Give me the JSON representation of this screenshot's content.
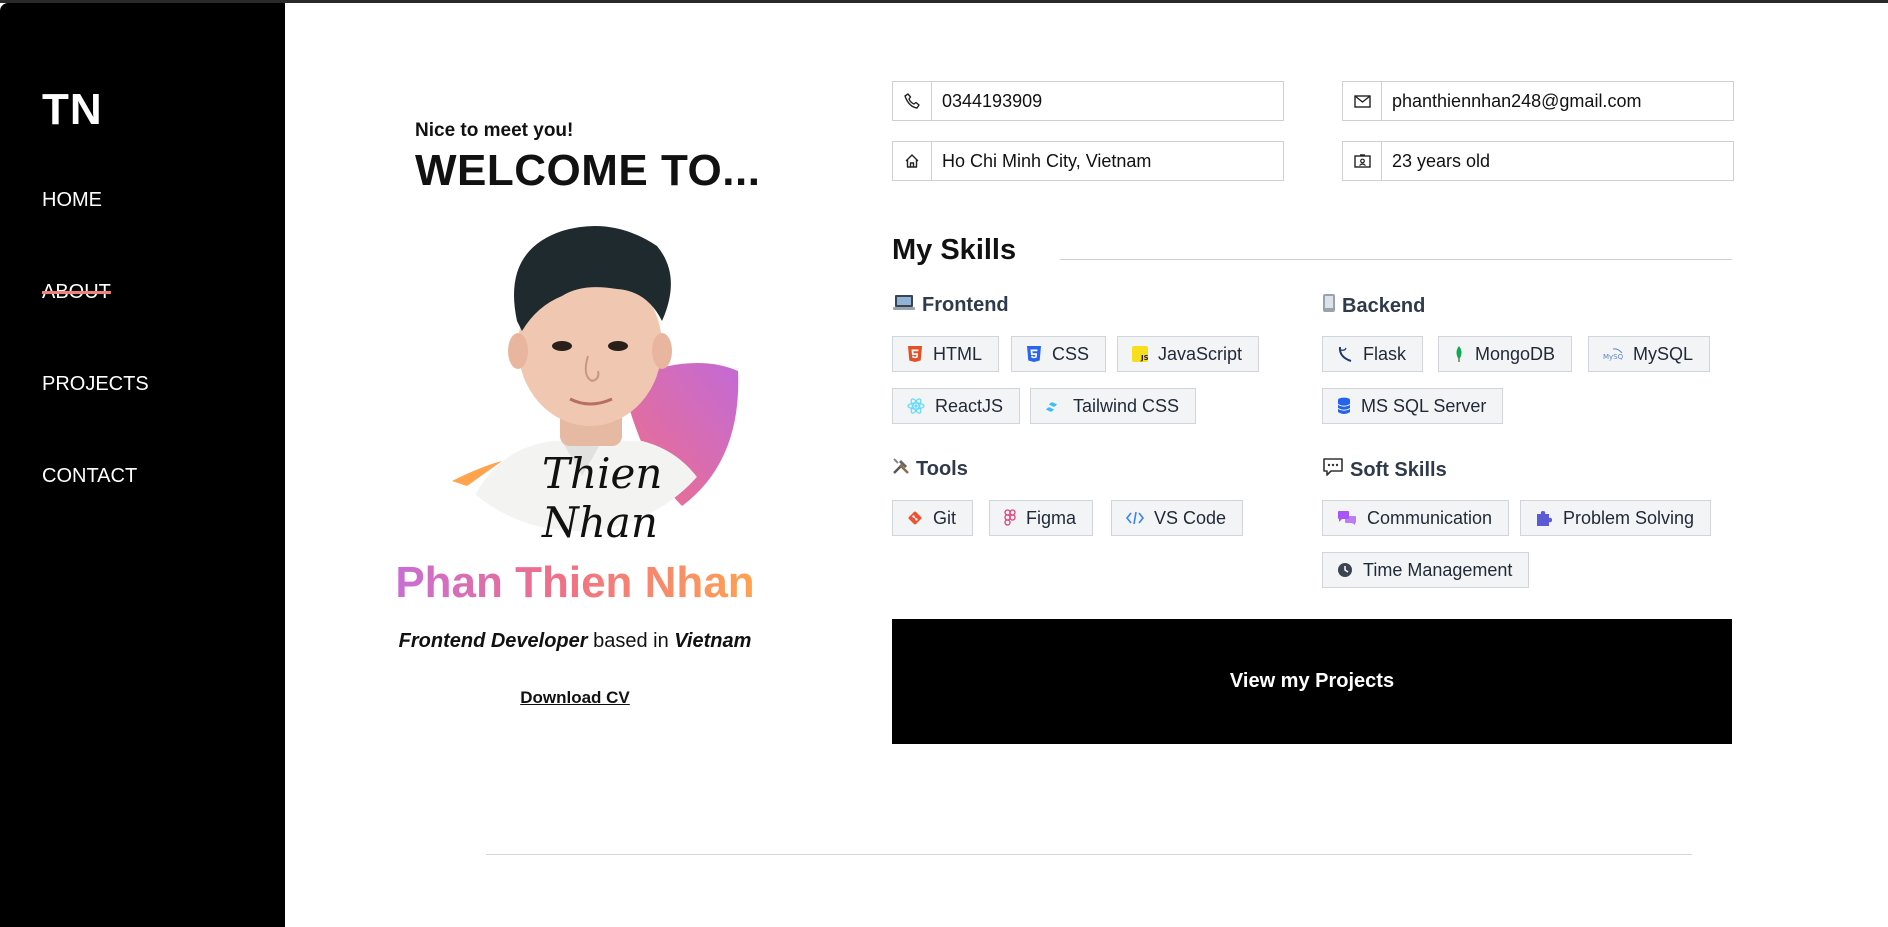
{
  "sidebar": {
    "logo": "TN",
    "nav": [
      {
        "label": "HOME"
      },
      {
        "label": "ABOUT",
        "active": true
      },
      {
        "label": "PROJECTS"
      },
      {
        "label": "CONTACT"
      }
    ]
  },
  "hero": {
    "greeting": "Nice to meet you!",
    "welcome": "WELCOME TO...",
    "signature": "Thien Nhan",
    "name": "Phan Thien Nhan",
    "tagline_role": "Frontend Developer",
    "tagline_mid": " based in ",
    "tagline_place": "Vietnam",
    "download_label": "Download CV"
  },
  "info": {
    "phone": {
      "icon": "phone-icon",
      "value": "0344193909"
    },
    "email": {
      "icon": "mail-icon",
      "value": "phanthiennhan248@gmail.com"
    },
    "location": {
      "icon": "home-icon",
      "value": "Ho Chi Minh City, Vietnam"
    },
    "age": {
      "icon": "id-card-icon",
      "value": "23 years old"
    }
  },
  "skills": {
    "title": "My Skills",
    "frontend": {
      "label": "Frontend",
      "icon": "laptop-icon",
      "items": [
        "HTML",
        "CSS",
        "JavaScript",
        "ReactJS",
        "Tailwind CSS"
      ]
    },
    "backend": {
      "label": "Backend",
      "icon": "phone-device-icon",
      "items": [
        "Flask",
        "MongoDB",
        "MySQL",
        "MS SQL Server"
      ]
    },
    "tools": {
      "label": "Tools",
      "icon": "tools-icon",
      "items": [
        "Git",
        "Figma",
        "VS Code"
      ]
    },
    "soft": {
      "label": "Soft Skills",
      "icon": "speech-bubble-icon",
      "items": [
        "Communication",
        "Problem Solving",
        "Time Management"
      ]
    }
  },
  "cta": {
    "label": "View my Projects"
  },
  "colors": {
    "name_gradient": [
      "#c86dd7",
      "#f06f87",
      "#ffa34f"
    ],
    "sidebar_bg": "#000000",
    "chip_bg": "#f3f4f6"
  }
}
